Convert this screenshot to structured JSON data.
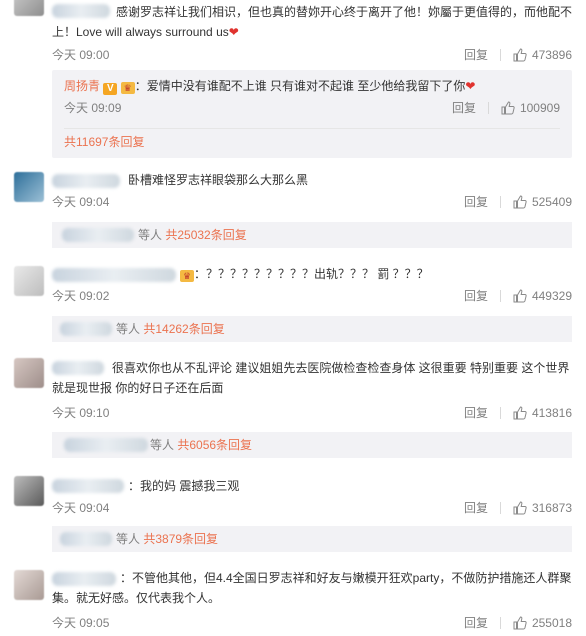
{
  "comments": [
    {
      "text": "感谢罗志祥让我们相识，但也真的替妳开心终于离开了他！妳屬于更值得的，而他配不上！Love will always surround us",
      "heart": "❤",
      "time": "今天 09:00",
      "reply_label": "回复",
      "likes": "473896",
      "sub_reply": {
        "name": "周扬青",
        "badge": "V",
        "text": "：爱情中没有谁配不上谁 只有谁对不起谁 至少他给我留下了你",
        "heart": "❤",
        "time": "今天 09:09",
        "reply_label": "回复",
        "likes": "100909"
      },
      "more_replies": "共11697条回复"
    },
    {
      "text": "卧槽难怪罗志祥眼袋那么大那么黑",
      "time": "今天 09:04",
      "reply_label": "回复",
      "likes": "525409",
      "summary_prefix": "等人",
      "summary_link": "共25032条回复"
    },
    {
      "text": "：？？？？？？？？？出轨？？？ 罰      ？？？",
      "time": "今天 09:02",
      "reply_label": "回复",
      "likes": "449329",
      "summary_prefix": "等人",
      "summary_link": "共14262条回复"
    },
    {
      "text": "很喜欢你也从不乱评论 建议姐姐先去医院做检查检查身体 这很重要 特别重要 这个世界就是现世报 你的好日子还在后面",
      "time": "今天 09:10",
      "reply_label": "回复",
      "likes": "413816",
      "summary_prefix": "等人",
      "summary_link": "共6056条回复"
    },
    {
      "text": "：我的妈 震撼我三观",
      "time": "今天 09:04",
      "reply_label": "回复",
      "likes": "316873",
      "summary_prefix": "等人",
      "summary_link": "共3879条回复"
    },
    {
      "text": "：不管他其他，但4.4全国日罗志祥和好友与嫩模开狂欢party，不做防护措施还人群聚集。就无好感。仅代表我个人。",
      "time": "今天 09:05",
      "reply_label": "回复",
      "likes": "255018"
    }
  ],
  "colors": {
    "accent": "#eb7350",
    "meta": "#808080",
    "subbox": "#f2f2f5"
  },
  "icons": {
    "like": "thumbs-up-icon",
    "heart": "heart-icon"
  }
}
